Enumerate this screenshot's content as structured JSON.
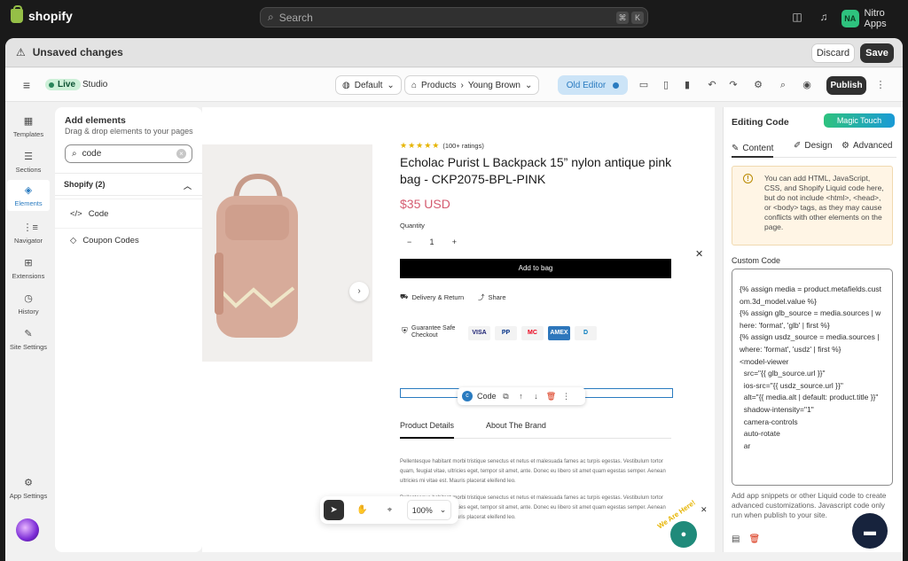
{
  "shopify": {
    "brand": "shopify",
    "search_placeholder": "Search",
    "shortcut_key1": "⌘",
    "shortcut_key2": "K",
    "user_initials": "NA",
    "user_name": "Nitro Apps"
  },
  "unsaved_bar": {
    "text": "Unsaved changes",
    "discard": "Discard",
    "save": "Save"
  },
  "toolbar": {
    "live_label": "Live",
    "studio_label": "Studio",
    "language": "Default",
    "breadcrumb_section": "Products",
    "breadcrumb_item": "Young Brown",
    "old_editor": "Old Editor",
    "publish": "Publish"
  },
  "rail": {
    "items": [
      {
        "label": "Templates",
        "icon": "templates-icon"
      },
      {
        "label": "Sections",
        "icon": "sections-icon"
      },
      {
        "label": "Elements",
        "icon": "elements-icon"
      },
      {
        "label": "Navigator",
        "icon": "navigator-icon"
      },
      {
        "label": "Extensions",
        "icon": "extensions-icon"
      },
      {
        "label": "History",
        "icon": "history-icon"
      },
      {
        "label": "Site Settings",
        "icon": "site-settings-icon"
      }
    ],
    "app_settings": "App Settings"
  },
  "add_elements": {
    "title": "Add elements",
    "subtitle": "Drag & drop elements to your pages",
    "search_value": "code",
    "group": "Shopify (2)",
    "items": [
      {
        "label": "Code",
        "icon": "code-icon"
      },
      {
        "label": "Coupon Codes",
        "icon": "tag-icon"
      }
    ]
  },
  "product": {
    "rating_count": "(100+ ratings)",
    "title": "Echolac Purist L Backpack 15” nylon antique pink bag - CKP2075-BPL-PINK",
    "price": "$35 USD",
    "quantity_label": "Quantity",
    "quantity_minus": "−",
    "quantity_value": "1",
    "quantity_plus": "+",
    "add_to_bag": "Add to bag",
    "delivery": "Delivery & Return",
    "share": "Share",
    "guarantee": "Guarantee Safe Checkout",
    "payments": [
      "VISA",
      "PP",
      "MC",
      "AMEX",
      "D"
    ],
    "tabs": [
      "Product Details",
      "About The Brand"
    ],
    "paragraph1": "Pellentesque habitant morbi tristique senectus et netus et malesuada fames ac turpis egestas. Vestibulum tortor quam, feugiat vitae, ultricies eget, tempor sit amet, ante. Donec eu libero sit amet quam egestas semper. Aenean ultricies mi vitae est. Mauris placerat eleifend leo.",
    "paragraph2": "Pellentesque habitant morbi tristique senectus et netus et malesuada fames ac turpis egestas. Vestibulum tortor quam, feugiat vitae, ultricies eget, tempor sit amet, ante. Donec eu libero sit amet quam egestas semper. Aenean ultricies mi vitae est. Mauris placerat eleifend leo."
  },
  "code_toolbar": {
    "label": "Code"
  },
  "canvas_controls": {
    "zoom": "100%"
  },
  "right_panel": {
    "title": "Editing Code",
    "magic_touch": "Magic Touch",
    "tabs": [
      "Content",
      "Design",
      "Advanced"
    ],
    "notice": "You can add HTML, JavaScript, CSS, and Shopify Liquid code here, but do not include <html>, <head>, or <body> tags, as they may cause conflicts with other elements on the page.",
    "custom_code_label": "Custom Code",
    "custom_code": "{% assign media = product.metafields.custom.3d_model.value %}\n{% assign glb_source = media.sources | where: 'format', 'glb' | first %}\n{% assign usdz_source = media.sources | where: 'format', 'usdz' | first %}\n<model-viewer\n  src=\"{{ glb_source.url }}\"\n  ios-src=\"{{ usdz_source.url }}\"\n  alt=\"{{ media.alt | default: product.title }}\"\n  shadow-intensity=\"1\"\n  camera-controls\n  auto-rotate\n  ar",
    "help": "Add app snippets or other Liquid code to create advanced customizations. Javascript code only run when publish to your site."
  },
  "help_badge": {
    "text": "We Are Here!"
  },
  "colors": {
    "accent": "#2a7bc0",
    "price": "#d45b70",
    "live": "#29845a",
    "dark": "#303030"
  }
}
